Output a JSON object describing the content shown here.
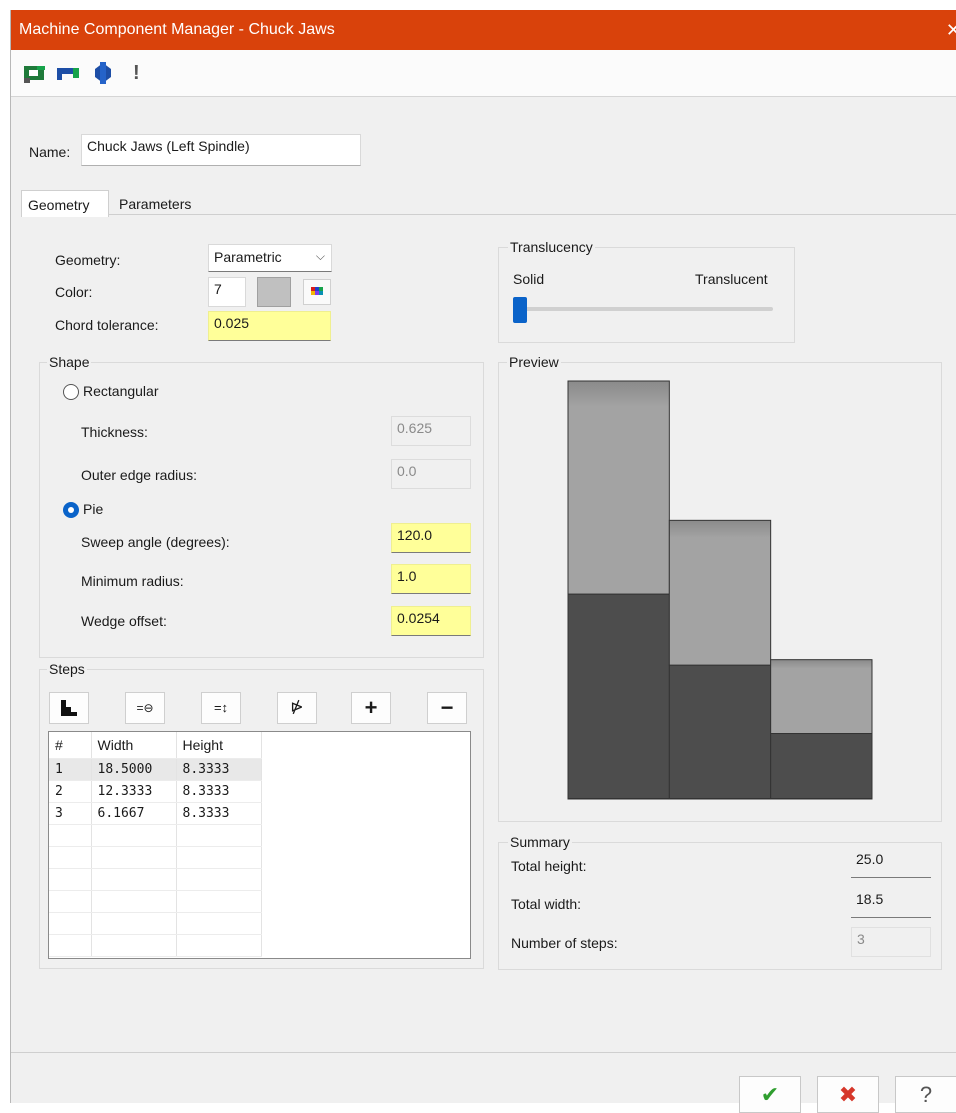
{
  "window": {
    "title": "Machine Component Manager - Chuck Jaws",
    "close_glyph": "✕"
  },
  "toolbar": {
    "icons": [
      "stock-component-icon",
      "chuck-jaws-icon",
      "gear-component-icon",
      "warning-icon"
    ],
    "warning_glyph": "!"
  },
  "name_field": {
    "label": "Name:",
    "value": "Chuck Jaws (Left Spindle)"
  },
  "tabs": [
    {
      "label": "Geometry",
      "active": true
    },
    {
      "label": "Parameters",
      "active": false
    }
  ],
  "geometry": {
    "geometry_label": "Geometry:",
    "geometry_value": "Parametric",
    "color_label": "Color:",
    "color_value": "7",
    "color_swatch": "#c0c0c0",
    "chord_label": "Chord tolerance:",
    "chord_value": "0.025"
  },
  "translucency": {
    "title": "Translucency",
    "left_label": "Solid",
    "right_label": "Translucent",
    "level": 0
  },
  "shape": {
    "title": "Shape",
    "rect_label": "Rectangular",
    "rect_selected": false,
    "thickness_label": "Thickness:",
    "thickness_value": "0.625",
    "outer_edge_label": "Outer edge radius:",
    "outer_edge_value": "0.0",
    "pie_label": "Pie",
    "pie_selected": true,
    "sweep_label": "Sweep angle (degrees):",
    "sweep_value": "120.0",
    "min_radius_label": "Minimum radius:",
    "min_radius_value": "1.0",
    "wedge_label": "Wedge offset:",
    "wedge_value": "0.0254"
  },
  "steps": {
    "title": "Steps",
    "buttons": [
      "staircase-icon",
      "equal-width-icon",
      "equal-height-icon",
      "reverse-icon",
      "add-icon",
      "remove-icon"
    ],
    "button_glyphs": {
      "equal_width": "=⊖",
      "equal_height": "=↕",
      "reverse": "⋫",
      "add": "+",
      "remove": "−"
    },
    "columns": [
      "#",
      "Width",
      "Height"
    ],
    "rows": [
      {
        "n": "1",
        "width": "18.5000",
        "height": "8.3333"
      },
      {
        "n": "2",
        "width": "12.3333",
        "height": "8.3333"
      },
      {
        "n": "3",
        "width": "6.1667",
        "height": "8.3333"
      }
    ]
  },
  "preview": {
    "title": "Preview",
    "light_color": "#999999",
    "dark_color": "#4d4d4d"
  },
  "summary": {
    "title": "Summary",
    "total_height_label": "Total height:",
    "total_height_value": "25.0",
    "total_width_label": "Total width:",
    "total_width_value": "18.5",
    "num_steps_label": "Number of steps:",
    "num_steps_value": "3"
  },
  "footer": {
    "ok_glyph": "✔",
    "cancel_glyph": "✖",
    "help_glyph": "?",
    "ok_color": "#2f9e2f",
    "cancel_color": "#d6372a"
  }
}
